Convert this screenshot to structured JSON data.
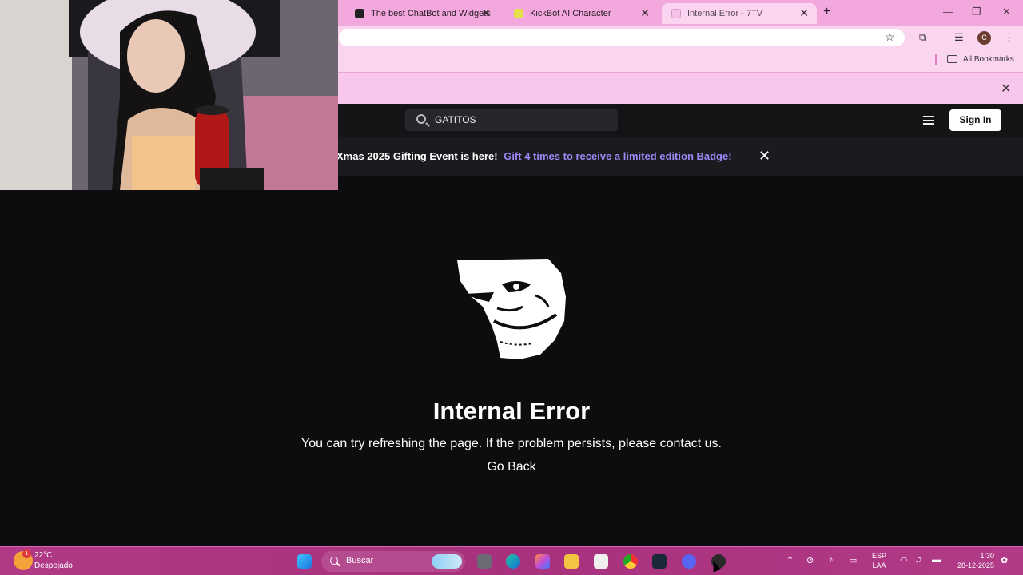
{
  "browser": {
    "tabs": [
      {
        "title": "The best ChatBot and Widgets",
        "favicon": "chatbot-icon",
        "active": false
      },
      {
        "title": "KickBot AI Character",
        "favicon": "kickbot-icon",
        "active": false
      },
      {
        "title": "Internal Error - 7TV",
        "favicon": "7tv-icon",
        "active": true
      }
    ],
    "new_tab": "+",
    "close_glyph": "✕",
    "profile_initial": "C",
    "bookmarks_label": "All Bookmarks"
  },
  "site": {
    "search_value": "GATITOS",
    "sign_in_label": "Sign In",
    "event_text": "Xmas 2025 Gifting Event is here!",
    "event_link": "Gift 4 times to receive a limited edition Badge!",
    "close_glyph": "✕"
  },
  "error": {
    "image": "trollface-icon",
    "title": "Internal Error",
    "message": "You can try refreshing the page. If the problem persists, please contact us.",
    "go_back": "Go Back"
  },
  "webcam": {
    "description_icon": "webcam-overlay"
  },
  "taskbar": {
    "weather_temp": "22°C",
    "weather_desc": "Despejado",
    "weather_badge": "1",
    "search_label": "Buscar",
    "lang_line1": "ESP",
    "lang_line2": "LAA",
    "time": "1:30",
    "date": "28-12-2025"
  },
  "colors": {
    "browser_accent": "#f2a8dc",
    "page_bg": "#0d0d0f",
    "event_link": "#9d86f5",
    "taskbar": "#a8317e"
  }
}
